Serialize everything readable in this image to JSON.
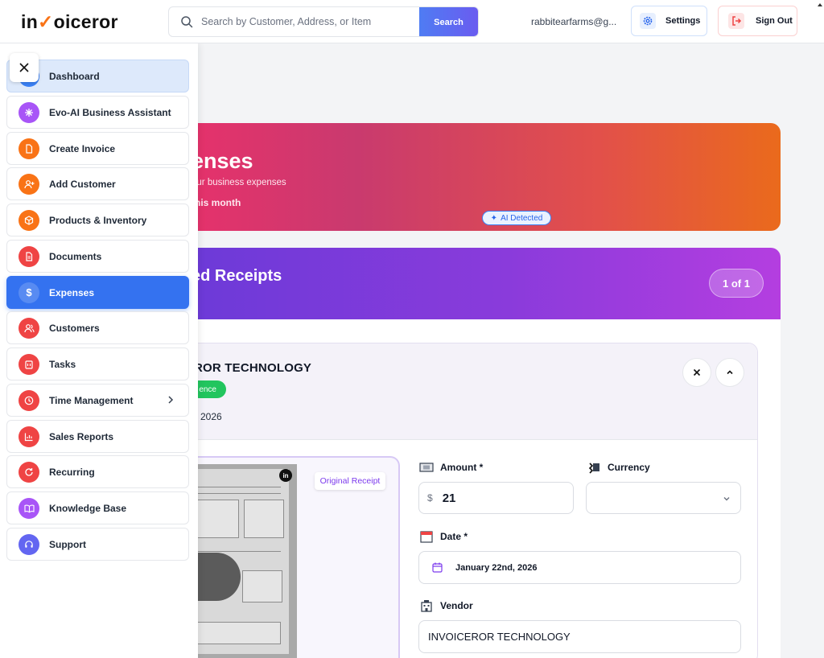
{
  "header": {
    "logo_pre": "in",
    "logo_post": "oiceror",
    "search_placeholder": "Search by Customer, Address, or Item",
    "search_button": "Search",
    "user_email": "rabbitearfarms@g...",
    "settings_label": "Settings",
    "signout_label": "Sign Out"
  },
  "sidebar": {
    "items": [
      {
        "label": "Dashboard",
        "icon": "dashboard-icon",
        "color": "#3b82f6"
      },
      {
        "label": "Evo-AI Business Assistant",
        "icon": "sparkle-icon",
        "color": "#a855f7"
      },
      {
        "label": "Create Invoice",
        "icon": "file-icon",
        "color": "#f97316"
      },
      {
        "label": "Add Customer",
        "icon": "user-plus-icon",
        "color": "#f97316"
      },
      {
        "label": "Products & Inventory",
        "icon": "box-icon",
        "color": "#f97316"
      },
      {
        "label": "Documents",
        "icon": "document-icon",
        "color": "#ef4444"
      },
      {
        "label": "Expenses",
        "icon": "dollar-icon",
        "color": "#ffffff"
      },
      {
        "label": "Customers",
        "icon": "users-icon",
        "color": "#ef4444"
      },
      {
        "label": "Tasks",
        "icon": "clipboard-icon",
        "color": "#ef4444"
      },
      {
        "label": "Time Management",
        "icon": "clock-icon",
        "color": "#ef4444"
      },
      {
        "label": "Sales Reports",
        "icon": "chart-icon",
        "color": "#ef4444"
      },
      {
        "label": "Recurring",
        "icon": "refresh-icon",
        "color": "#ef4444"
      },
      {
        "label": "Knowledge Base",
        "icon": "book-icon",
        "color": "#a855f7"
      },
      {
        "label": "Support",
        "icon": "headset-icon",
        "color": "#6366f1"
      }
    ]
  },
  "hero": {
    "title": "enses",
    "subtitle": "our business expenses",
    "month": "this month"
  },
  "receipts": {
    "title": "ed Receipts",
    "pager": "1 of 1"
  },
  "receipt_card": {
    "vendor_name": "ROR TECHNOLOGY",
    "confidence": "ence",
    "date": "2026",
    "original_badge": "Original Receipt",
    "amount_label": "Amount *",
    "amount_prefix": "$",
    "amount_value": "21",
    "currency_label": "Currency",
    "ai_badge": "AI Detected",
    "date_label": "Date *",
    "date_value": "January 22nd, 2026",
    "vendor_label": "Vendor",
    "vendor_value": "INVOICEROR TECHNOLOGY"
  },
  "colors": {
    "accent": "#3472f0",
    "hero_start": "#e8316b",
    "hero_end": "#ea6a1c",
    "receipts_start": "#6b3ad8",
    "receipts_end": "#b43ee0"
  }
}
